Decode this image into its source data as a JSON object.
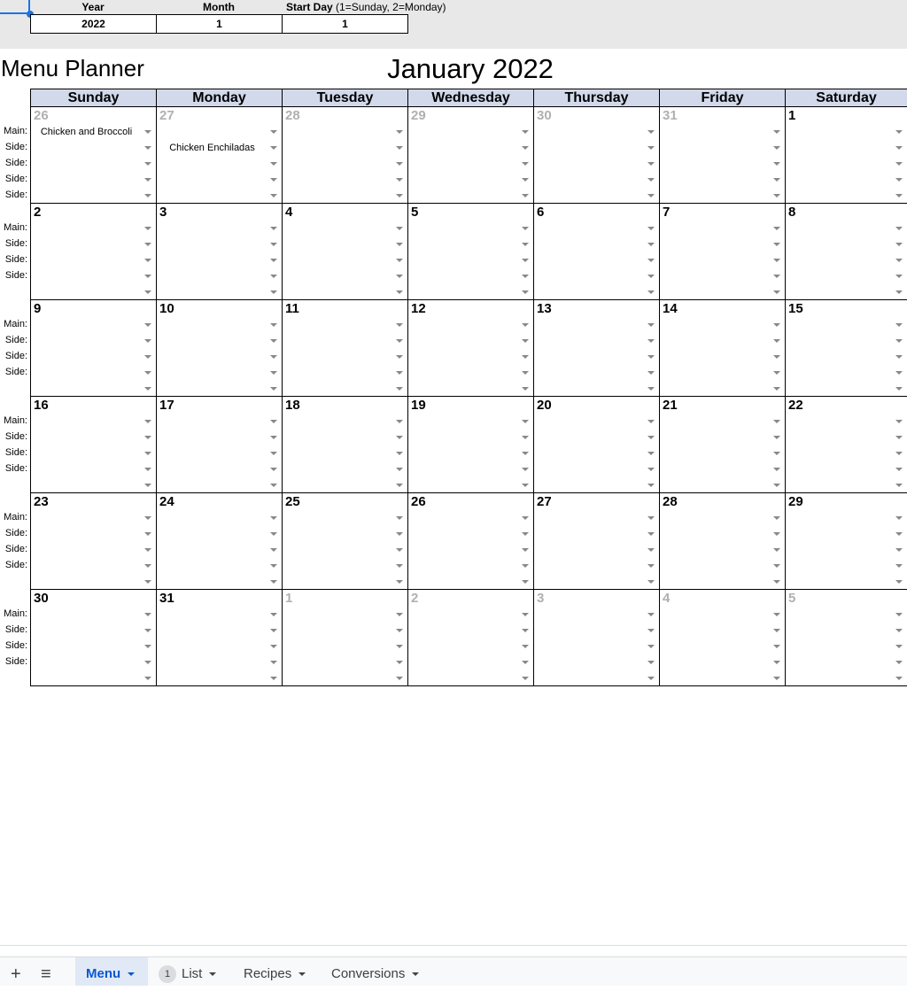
{
  "params": {
    "headers": [
      "Year",
      "Month",
      "Start Day"
    ],
    "start_day_note": "(1=Sunday, 2=Monday)",
    "values": [
      "2022",
      "1",
      "1"
    ]
  },
  "title": "Menu Planner",
  "month_title": "January 2022",
  "weekdays": [
    "Sunday",
    "Monday",
    "Tuesday",
    "Wednesday",
    "Thursday",
    "Friday",
    "Saturday"
  ],
  "slot_labels_first": [
    "Main:",
    "Side:",
    "Side:",
    "Side:",
    "Side:"
  ],
  "slot_labels": [
    "Main:",
    "Side:",
    "Side:",
    "Side:",
    ""
  ],
  "weeks": [
    [
      {
        "d": "26",
        "m": true,
        "slots": [
          "Chicken and Broccoli",
          "",
          "",
          "",
          ""
        ]
      },
      {
        "d": "27",
        "m": true,
        "slots": [
          "",
          "Chicken Enchiladas",
          "",
          "",
          ""
        ]
      },
      {
        "d": "28",
        "m": true
      },
      {
        "d": "29",
        "m": true
      },
      {
        "d": "30",
        "m": true
      },
      {
        "d": "31",
        "m": true
      },
      {
        "d": "1"
      }
    ],
    [
      {
        "d": "2"
      },
      {
        "d": "3"
      },
      {
        "d": "4"
      },
      {
        "d": "5"
      },
      {
        "d": "6"
      },
      {
        "d": "7"
      },
      {
        "d": "8"
      }
    ],
    [
      {
        "d": "9"
      },
      {
        "d": "10"
      },
      {
        "d": "11"
      },
      {
        "d": "12"
      },
      {
        "d": "13"
      },
      {
        "d": "14"
      },
      {
        "d": "15"
      }
    ],
    [
      {
        "d": "16"
      },
      {
        "d": "17"
      },
      {
        "d": "18"
      },
      {
        "d": "19"
      },
      {
        "d": "20"
      },
      {
        "d": "21"
      },
      {
        "d": "22"
      }
    ],
    [
      {
        "d": "23"
      },
      {
        "d": "24"
      },
      {
        "d": "25"
      },
      {
        "d": "26"
      },
      {
        "d": "27"
      },
      {
        "d": "28"
      },
      {
        "d": "29"
      }
    ],
    [
      {
        "d": "30"
      },
      {
        "d": "31"
      },
      {
        "d": "1",
        "m": true
      },
      {
        "d": "2",
        "m": true
      },
      {
        "d": "3",
        "m": true
      },
      {
        "d": "4",
        "m": true
      },
      {
        "d": "5",
        "m": true
      }
    ]
  ],
  "tabs": {
    "add": "+",
    "all": "≡",
    "items": [
      {
        "label": "Menu",
        "active": true
      },
      {
        "label": "List",
        "badge": "1"
      },
      {
        "label": "Recipes"
      },
      {
        "label": "Conversions"
      }
    ]
  },
  "colors": {
    "header": "#d1d9ea",
    "accent": "#1a73e8",
    "muted": "#b0b0b0"
  }
}
